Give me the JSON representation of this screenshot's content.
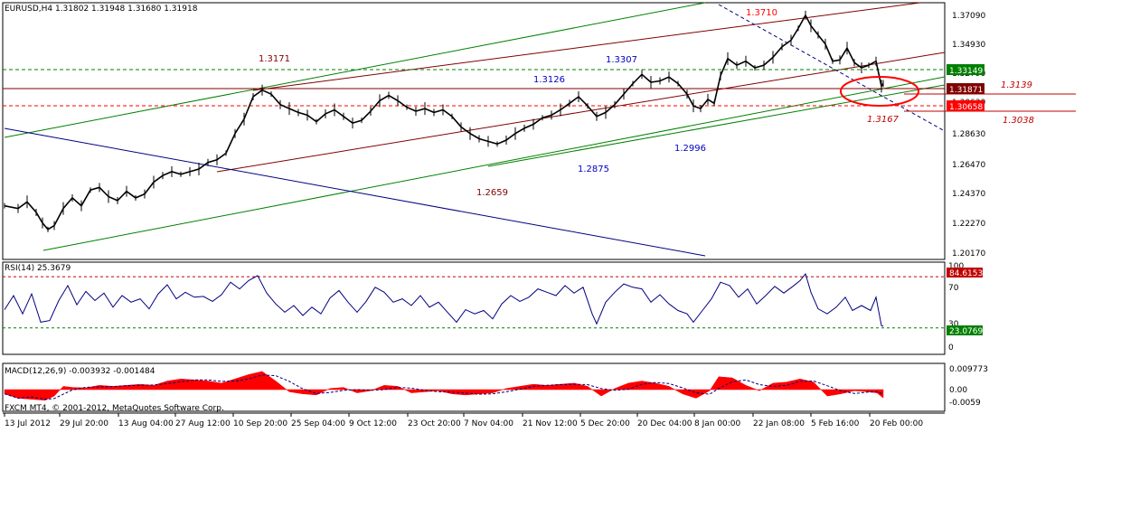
{
  "chart_data": {
    "type": "candlestick",
    "symbol_header": {
      "symbol": "EURUSD,H4",
      "open": "1.31802",
      "high": "1.31948",
      "low": "1.31680",
      "close": "1.31918"
    },
    "price_axis": {
      "ylim": [
        1.195,
        1.382
      ],
      "ticks": [
        "1.37090",
        "1.34930",
        "1.32790",
        "1.30630",
        "1.28630",
        "1.26470",
        "1.24370",
        "1.22270",
        "1.20170"
      ]
    },
    "price_series": [
      [
        0,
        1.226
      ],
      [
        15,
        1.224
      ],
      [
        25,
        1.229
      ],
      [
        35,
        1.221
      ],
      [
        42,
        1.213
      ],
      [
        48,
        1.208
      ],
      [
        55,
        1.211
      ],
      [
        65,
        1.224
      ],
      [
        75,
        1.232
      ],
      [
        85,
        1.226
      ],
      [
        95,
        1.238
      ],
      [
        105,
        1.24
      ],
      [
        115,
        1.233
      ],
      [
        125,
        1.23
      ],
      [
        135,
        1.237
      ],
      [
        145,
        1.232
      ],
      [
        155,
        1.235
      ],
      [
        165,
        1.244
      ],
      [
        175,
        1.249
      ],
      [
        185,
        1.252
      ],
      [
        195,
        1.25
      ],
      [
        205,
        1.252
      ],
      [
        215,
        1.254
      ],
      [
        225,
        1.259
      ],
      [
        235,
        1.261
      ],
      [
        245,
        1.266
      ],
      [
        255,
        1.281
      ],
      [
        265,
        1.292
      ],
      [
        275,
        1.309
      ],
      [
        285,
        1.314
      ],
      [
        295,
        1.311
      ],
      [
        305,
        1.303
      ],
      [
        315,
        1.3
      ],
      [
        325,
        1.297
      ],
      [
        335,
        1.295
      ],
      [
        345,
        1.29
      ],
      [
        355,
        1.296
      ],
      [
        365,
        1.299
      ],
      [
        375,
        1.294
      ],
      [
        385,
        1.289
      ],
      [
        395,
        1.291
      ],
      [
        405,
        1.298
      ],
      [
        415,
        1.306
      ],
      [
        425,
        1.31
      ],
      [
        435,
        1.306
      ],
      [
        445,
        1.301
      ],
      [
        455,
        1.298
      ],
      [
        465,
        1.3
      ],
      [
        475,
        1.297
      ],
      [
        485,
        1.299
      ],
      [
        495,
        1.294
      ],
      [
        505,
        1.286
      ],
      [
        515,
        1.281
      ],
      [
        525,
        1.277
      ],
      [
        535,
        1.275
      ],
      [
        545,
        1.273
      ],
      [
        555,
        1.276
      ],
      [
        565,
        1.281
      ],
      [
        575,
        1.285
      ],
      [
        585,
        1.288
      ],
      [
        595,
        1.293
      ],
      [
        605,
        1.295
      ],
      [
        615,
        1.299
      ],
      [
        625,
        1.304
      ],
      [
        635,
        1.309
      ],
      [
        645,
        1.302
      ],
      [
        655,
        1.294
      ],
      [
        665,
        1.297
      ],
      [
        675,
        1.303
      ],
      [
        685,
        1.311
      ],
      [
        695,
        1.319
      ],
      [
        705,
        1.326
      ],
      [
        715,
        1.32
      ],
      [
        725,
        1.321
      ],
      [
        735,
        1.324
      ],
      [
        745,
        1.319
      ],
      [
        755,
        1.311
      ],
      [
        762,
        1.302
      ],
      [
        770,
        1.3
      ],
      [
        778,
        1.307
      ],
      [
        785,
        1.304
      ],
      [
        792,
        1.325
      ],
      [
        800,
        1.338
      ],
      [
        810,
        1.333
      ],
      [
        820,
        1.336
      ],
      [
        830,
        1.331
      ],
      [
        840,
        1.333
      ],
      [
        850,
        1.339
      ],
      [
        860,
        1.347
      ],
      [
        870,
        1.352
      ],
      [
        878,
        1.361
      ],
      [
        886,
        1.371
      ],
      [
        892,
        1.363
      ],
      [
        900,
        1.356
      ],
      [
        908,
        1.349
      ],
      [
        916,
        1.336
      ],
      [
        924,
        1.337
      ],
      [
        932,
        1.346
      ],
      [
        940,
        1.335
      ],
      [
        948,
        1.331
      ],
      [
        956,
        1.333
      ],
      [
        964,
        1.336
      ],
      [
        970,
        1.317
      ],
      [
        972,
        1.319
      ]
    ],
    "horizontal_levels": [
      {
        "value": "1.33149",
        "color": "#008000"
      },
      {
        "value": "1.31871",
        "color": "#800000"
      },
      {
        "value": "1.30658",
        "color": "#ff0000"
      }
    ],
    "annotations": [
      "1.3710",
      "1.3171",
      "1.3307",
      "1.3126",
      "1.2996",
      "1.2875",
      "1.2659",
      "1.3139",
      "1.3167",
      "1.3038"
    ],
    "rsi": {
      "label": "RSI(14) 25.3679",
      "ticks": [
        "100",
        "70",
        "30",
        "0"
      ],
      "upper_level": "84.6153",
      "lower_level": "23.0769",
      "values": [
        [
          0,
          45
        ],
        [
          10,
          62
        ],
        [
          20,
          40
        ],
        [
          30,
          64
        ],
        [
          40,
          30
        ],
        [
          50,
          32
        ],
        [
          60,
          56
        ],
        [
          70,
          74
        ],
        [
          80,
          51
        ],
        [
          90,
          67
        ],
        [
          100,
          56
        ],
        [
          110,
          65
        ],
        [
          120,
          48
        ],
        [
          130,
          62
        ],
        [
          140,
          54
        ],
        [
          150,
          58
        ],
        [
          160,
          46
        ],
        [
          170,
          64
        ],
        [
          180,
          75
        ],
        [
          190,
          58
        ],
        [
          200,
          66
        ],
        [
          210,
          60
        ],
        [
          220,
          61
        ],
        [
          230,
          55
        ],
        [
          240,
          63
        ],
        [
          250,
          78
        ],
        [
          260,
          70
        ],
        [
          270,
          80
        ],
        [
          280,
          86
        ],
        [
          290,
          65
        ],
        [
          300,
          52
        ],
        [
          310,
          42
        ],
        [
          320,
          50
        ],
        [
          330,
          38
        ],
        [
          340,
          48
        ],
        [
          350,
          40
        ],
        [
          360,
          59
        ],
        [
          370,
          68
        ],
        [
          380,
          54
        ],
        [
          390,
          42
        ],
        [
          400,
          55
        ],
        [
          410,
          72
        ],
        [
          420,
          66
        ],
        [
          430,
          54
        ],
        [
          440,
          58
        ],
        [
          450,
          50
        ],
        [
          460,
          62
        ],
        [
          470,
          48
        ],
        [
          480,
          54
        ],
        [
          490,
          42
        ],
        [
          500,
          30
        ],
        [
          510,
          45
        ],
        [
          520,
          40
        ],
        [
          530,
          44
        ],
        [
          540,
          34
        ],
        [
          550,
          52
        ],
        [
          560,
          62
        ],
        [
          570,
          55
        ],
        [
          580,
          60
        ],
        [
          590,
          70
        ],
        [
          600,
          66
        ],
        [
          610,
          62
        ],
        [
          620,
          74
        ],
        [
          630,
          65
        ],
        [
          640,
          72
        ],
        [
          650,
          40
        ],
        [
          655,
          28
        ],
        [
          665,
          54
        ],
        [
          675,
          66
        ],
        [
          685,
          76
        ],
        [
          695,
          72
        ],
        [
          705,
          70
        ],
        [
          715,
          54
        ],
        [
          725,
          63
        ],
        [
          735,
          52
        ],
        [
          745,
          44
        ],
        [
          755,
          40
        ],
        [
          762,
          30
        ],
        [
          772,
          44
        ],
        [
          782,
          58
        ],
        [
          792,
          78
        ],
        [
          802,
          74
        ],
        [
          812,
          60
        ],
        [
          822,
          70
        ],
        [
          832,
          52
        ],
        [
          842,
          62
        ],
        [
          852,
          73
        ],
        [
          862,
          65
        ],
        [
          872,
          73
        ],
        [
          880,
          80
        ],
        [
          886,
          88
        ],
        [
          892,
          66
        ],
        [
          900,
          46
        ],
        [
          910,
          40
        ],
        [
          920,
          48
        ],
        [
          930,
          60
        ],
        [
          938,
          44
        ],
        [
          948,
          50
        ],
        [
          958,
          44
        ],
        [
          964,
          60
        ],
        [
          970,
          26
        ],
        [
          972,
          25
        ]
      ]
    },
    "macd": {
      "label": "MACD(12,26,9) -0.003932 -0.001484",
      "ticks": [
        "0.009773",
        "0.00",
        "-0.0059"
      ],
      "values": [
        [
          0,
          -0.002
        ],
        [
          15,
          -0.004
        ],
        [
          30,
          -0.0045
        ],
        [
          45,
          -0.005
        ],
        [
          55,
          -0.003
        ],
        [
          65,
          0.0015
        ],
        [
          75,
          0.001
        ],
        [
          90,
          0.0008
        ],
        [
          105,
          0.002
        ],
        [
          120,
          0.0015
        ],
        [
          135,
          0.002
        ],
        [
          150,
          0.0025
        ],
        [
          165,
          0.002
        ],
        [
          180,
          0.004
        ],
        [
          195,
          0.005
        ],
        [
          210,
          0.0045
        ],
        [
          225,
          0.004
        ],
        [
          240,
          0.003
        ],
        [
          255,
          0.005
        ],
        [
          270,
          0.007
        ],
        [
          285,
          0.0085
        ],
        [
          300,
          0.004
        ],
        [
          315,
          -0.001
        ],
        [
          330,
          -0.002
        ],
        [
          345,
          -0.0025
        ],
        [
          360,
          0.0005
        ],
        [
          375,
          0.001
        ],
        [
          390,
          -0.0015
        ],
        [
          405,
          -0.0005
        ],
        [
          420,
          0.002
        ],
        [
          435,
          0.0015
        ],
        [
          450,
          -0.0015
        ],
        [
          465,
          -0.001
        ],
        [
          480,
          -0.0005
        ],
        [
          495,
          -0.002
        ],
        [
          510,
          -0.0025
        ],
        [
          525,
          -0.002
        ],
        [
          540,
          -0.0015
        ],
        [
          555,
          0.0005
        ],
        [
          570,
          0.0015
        ],
        [
          585,
          0.0025
        ],
        [
          600,
          0.002
        ],
        [
          615,
          0.0025
        ],
        [
          630,
          0.003
        ],
        [
          645,
          0.0015
        ],
        [
          660,
          -0.003
        ],
        [
          675,
          0.0005
        ],
        [
          690,
          0.003
        ],
        [
          705,
          0.004
        ],
        [
          720,
          0.003
        ],
        [
          735,
          0.0015
        ],
        [
          750,
          -0.002
        ],
        [
          765,
          -0.004
        ],
        [
          780,
          -0.0005
        ],
        [
          790,
          0.006
        ],
        [
          805,
          0.0055
        ],
        [
          820,
          0.002
        ],
        [
          835,
          -0.0005
        ],
        [
          850,
          0.003
        ],
        [
          865,
          0.0035
        ],
        [
          880,
          0.005
        ],
        [
          895,
          0.0035
        ],
        [
          910,
          -0.003
        ],
        [
          925,
          -0.002
        ],
        [
          940,
          -0.0005
        ],
        [
          955,
          -0.001
        ],
        [
          965,
          -0.0015
        ],
        [
          972,
          -0.0039
        ]
      ]
    },
    "x_axis": {
      "labels": [
        "13 Jul 2012",
        "29 Jul 20:00",
        "13 Aug 04:00",
        "27 Aug 12:00",
        "10 Sep 20:00",
        "25 Sep 04:00",
        "9 Oct 12:00",
        "23 Oct 20:00",
        "7 Nov 04:00",
        "21 Nov 12:00",
        "5 Dec 20:00",
        "20 Dec 04:00",
        "8 Jan 00:00",
        "22 Jan 08:00",
        "5 Feb 16:00",
        "20 Feb 00:00"
      ]
    },
    "watermark": "FXCM MT4, © 2001-2012, MetaQuotes Software Corp."
  }
}
